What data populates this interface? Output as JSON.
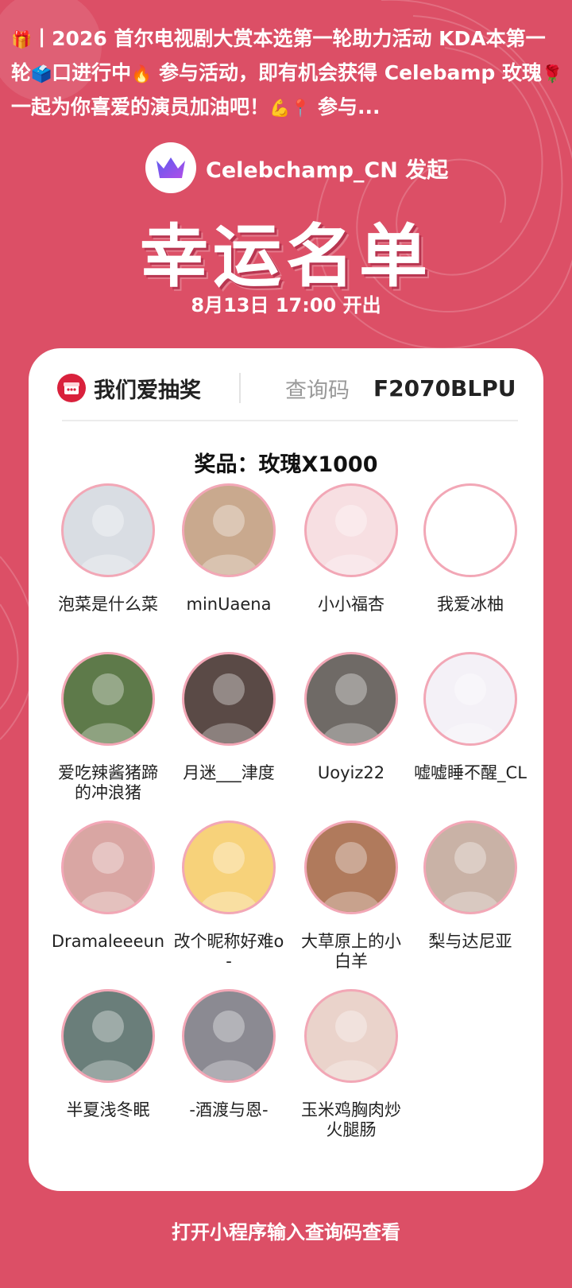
{
  "headline": {
    "gift_emoji": "🎁",
    "text_1": "丨2026 首尔电视剧大赏本选第一轮助力活动 KDA本第一轮",
    "ballot_emoji": "🗳️",
    "text_2": "口进行中",
    "fire_emoji": "🔥",
    "text_3": " 参与活动，即有机会获得 Celebamp 玫瑰",
    "rose_emoji": "🌹",
    "text_4": " 一起为你喜爱的演员加油吧！",
    "muscle_emoji": "💪",
    "pin_emoji": "📍",
    "text_5": " 参与..."
  },
  "initiator": {
    "by_text": "Celebchamp_CN 发起"
  },
  "title": "幸运名单",
  "draw_time": "8月13日 17:00 开出",
  "card": {
    "app_name": "我们爱抽奖",
    "code_label": "查询码",
    "code_value": "F2070BLPU",
    "prize": "奖品：玫瑰X1000"
  },
  "winners": [
    {
      "name": "泡菜是什么菜",
      "color": "#d9dde3"
    },
    {
      "name": "minUaena",
      "color": "#c9a98e"
    },
    {
      "name": "小小福杏",
      "color": "#f7dfe2"
    },
    {
      "name": "我爱冰柚",
      "color": "#ffffff"
    },
    {
      "name": "爱吃辣酱猪蹄的冲浪猪",
      "color": "#5e7a4a"
    },
    {
      "name": "月迷___津度",
      "color": "#5a4a46"
    },
    {
      "name": "Uoyiz22",
      "color": "#6f6a66"
    },
    {
      "name": "嘘嘘睡不醒_CL",
      "color": "#f4f1f7"
    },
    {
      "name": "Dramaleeeun",
      "color": "#d9a6a3"
    },
    {
      "name": "改个昵称好难o-",
      "color": "#f7d27a"
    },
    {
      "name": "大草原上的小白羊",
      "color": "#b07a5c"
    },
    {
      "name": "梨与达尼亚",
      "color": "#c9b2a6"
    },
    {
      "name": "半夏浅冬眠",
      "color": "#6a7e7a"
    },
    {
      "name": "-酒渡与恩-",
      "color": "#8b8a92"
    },
    {
      "name": "玉米鸡胸肉炒火腿肠",
      "color": "#ead3cb"
    }
  ],
  "footer": "打开小程序输入查询码查看"
}
